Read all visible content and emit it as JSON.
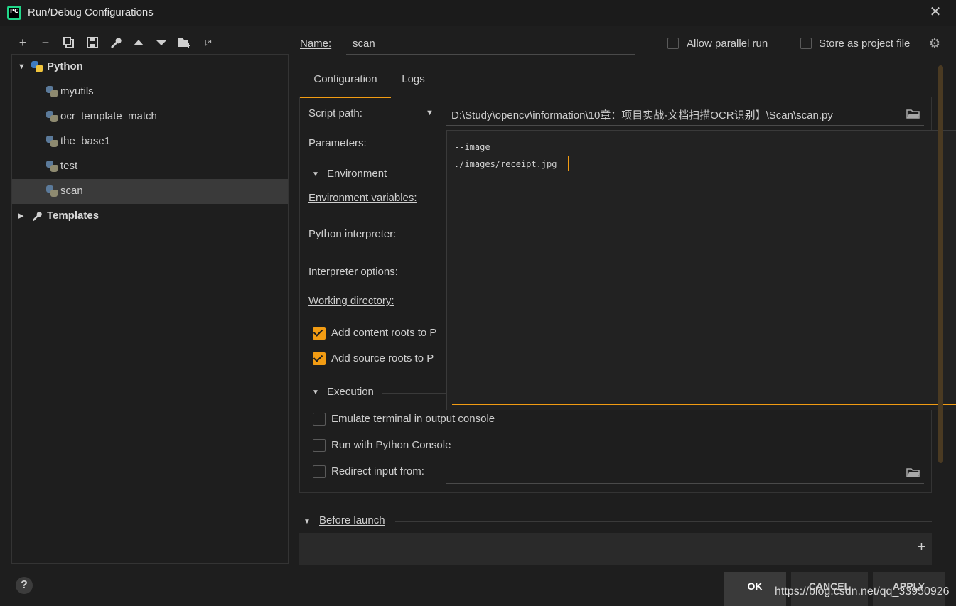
{
  "window": {
    "title": "Run/Debug Configurations",
    "app_icon": "PC"
  },
  "tree": {
    "python": {
      "label": "Python"
    },
    "items": [
      {
        "label": "myutils"
      },
      {
        "label": "ocr_template_match"
      },
      {
        "label": "the_base1"
      },
      {
        "label": "test"
      },
      {
        "label": "scan"
      }
    ],
    "templates": {
      "label": "Templates"
    }
  },
  "form": {
    "name_label": "Name:",
    "name_value": "scan",
    "allow_parallel": "Allow parallel run",
    "store_project": "Store as project file",
    "tabs": {
      "configuration": "Configuration",
      "logs": "Logs"
    },
    "script_path_label": "Script path:",
    "script_path_value": "D:\\Study\\opencv\\information\\10章：项目实战-文档扫描OCR识别】\\Scan\\scan.py",
    "parameters_label": "Parameters:",
    "parameters_lines": [
      "--image",
      "./images/receipt.jpg"
    ],
    "environment_section": "Environment",
    "env_vars_label": "Environment variables:",
    "interpreter_label": "Python interpreter:",
    "interp_options_label": "Interpreter options:",
    "working_dir_label": "Working directory:",
    "add_content_roots": "Add content roots to P",
    "add_source_roots": "Add source roots to P",
    "execution_section": "Execution",
    "emulate_terminal": "Emulate terminal in output console",
    "run_python_console": "Run with Python Console",
    "redirect_input": "Redirect input from:",
    "before_launch": "Before launch"
  },
  "buttons": {
    "help": "?",
    "ok": "OK",
    "cancel": "CANCEL",
    "apply": "APPLY"
  },
  "watermark": "https://blog.csdn.net/qq_33950926",
  "colors": {
    "accent": "#f29c13",
    "bg": "#1e1e1e"
  }
}
